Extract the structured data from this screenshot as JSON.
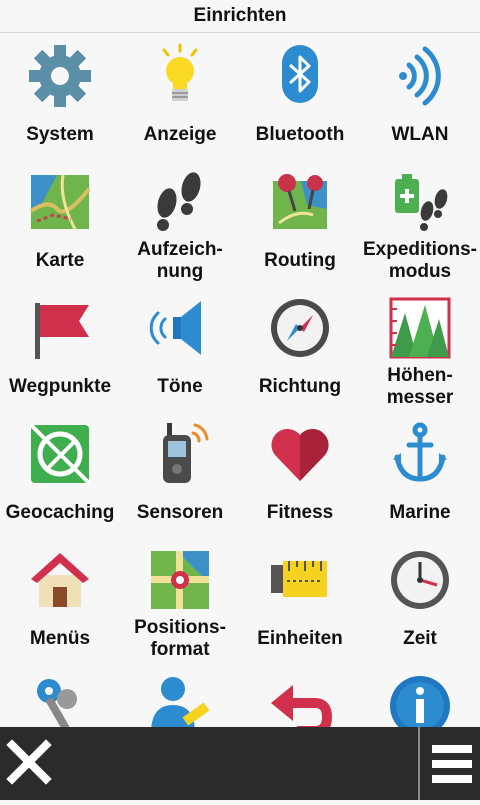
{
  "header": {
    "title": "Einrichten"
  },
  "tiles": [
    {
      "label": "System",
      "icon": "gear-icon"
    },
    {
      "label": "Anzeige",
      "icon": "lightbulb-icon"
    },
    {
      "label": "Bluetooth",
      "icon": "bluetooth-icon"
    },
    {
      "label": "WLAN",
      "icon": "wifi-icon"
    },
    {
      "label": "Karte",
      "icon": "map-icon"
    },
    {
      "label": "Aufzeich-\nnung",
      "icon": "footprints-icon"
    },
    {
      "label": "Routing",
      "icon": "route-pins-icon"
    },
    {
      "label": "Expeditions-\nmodus",
      "icon": "battery-footprints-icon"
    },
    {
      "label": "Wegpunkte",
      "icon": "flag-icon"
    },
    {
      "label": "Töne",
      "icon": "speaker-icon"
    },
    {
      "label": "Richtung",
      "icon": "compass-icon"
    },
    {
      "label": "Höhen-\nmesser",
      "icon": "altimeter-icon"
    },
    {
      "label": "Geocaching",
      "icon": "geocache-icon"
    },
    {
      "label": "Sensoren",
      "icon": "sensor-device-icon"
    },
    {
      "label": "Fitness",
      "icon": "heart-icon"
    },
    {
      "label": "Marine",
      "icon": "anchor-icon"
    },
    {
      "label": "Menüs",
      "icon": "house-icon"
    },
    {
      "label": "Positions-\nformat",
      "icon": "position-map-icon"
    },
    {
      "label": "Einheiten",
      "icon": "tape-measure-icon"
    },
    {
      "label": "Zeit",
      "icon": "clock-icon"
    },
    {
      "label": "",
      "icon": "keys-icon"
    },
    {
      "label": "",
      "icon": "user-edit-icon"
    },
    {
      "label": "",
      "icon": "reset-arrow-icon"
    },
    {
      "label": "",
      "icon": "info-icon"
    }
  ],
  "footer": {
    "close_icon": "close-icon",
    "menu_icon": "menu-icon"
  },
  "colors": {
    "background": "#f7f7f7",
    "footer": "#2b2b2b",
    "text": "#111111"
  }
}
